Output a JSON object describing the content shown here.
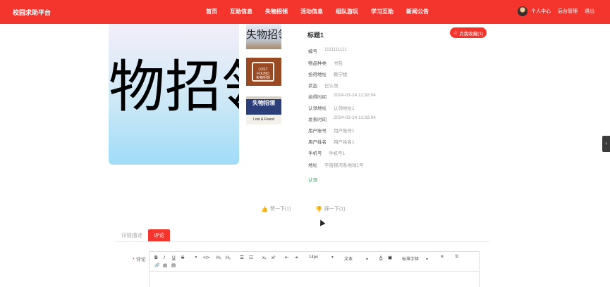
{
  "header": {
    "logo": "校园求助平台",
    "nav": [
      "首页",
      "互助信息",
      "失物招领",
      "活动信息",
      "组队游玩",
      "学习互助",
      "新闻公告"
    ],
    "user_links": [
      "个人中心",
      "后台管理",
      "退出"
    ]
  },
  "side_handle": "‹",
  "main_image_text": "物招领",
  "thumbnails": {
    "t1": "失物招领",
    "t2_line1": "LOST",
    "t2_line2": "FOUND",
    "t2_line3": "失物招领",
    "t3_line1": "失物招领",
    "t3_line2": "Lost & Found"
  },
  "detail": {
    "title": "标题1",
    "fav_star": "☆",
    "fav_label": "点我收藏(1)",
    "rows": [
      {
        "label": "编号",
        "value": "1111111111"
      },
      {
        "label": "物品种类",
        "value": "书包"
      },
      {
        "label": "拾得地址",
        "value": "教学楼"
      },
      {
        "label": "状态",
        "value": "已认领"
      },
      {
        "label": "拾得时间",
        "value": "2024-03-14 11:32:04"
      },
      {
        "label": "认领地址",
        "value": "认领地址1"
      },
      {
        "label": "发表时间",
        "value": "2024-03-14 11:32:04"
      },
      {
        "label": "用户账号",
        "value": "用户账号1"
      },
      {
        "label": "用户姓名",
        "value": "用户姓名1"
      },
      {
        "label": "手机号",
        "value": "手机号1"
      },
      {
        "label": "地址",
        "value": "宇宙银河系地球1号"
      }
    ],
    "action": "认领"
  },
  "votes": {
    "up_icon": "👍",
    "up_label": "赞一下(1)",
    "down_icon": "👎",
    "down_label": "踩一下(1)"
  },
  "tabs": [
    "详情描述",
    "评论"
  ],
  "comment": {
    "required_mark": "*",
    "label": "评论",
    "toolbar": {
      "bold": "B",
      "italic": "I",
      "underline": "U",
      "strike": "S",
      "quote": "❞",
      "code": "</>",
      "h1": "H₁",
      "h2": "H₂",
      "ol": "☰",
      "ul": "☷",
      "sub": "x₂",
      "sup": "x²",
      "outdent": "⇤",
      "indent": "⇥",
      "size": "14px",
      "header": "文本",
      "color": "A",
      "background": "▣",
      "font": "标准字体",
      "align": "≡",
      "clean": "T̸",
      "link": "🔗",
      "image": "▧",
      "video": "▤"
    }
  }
}
